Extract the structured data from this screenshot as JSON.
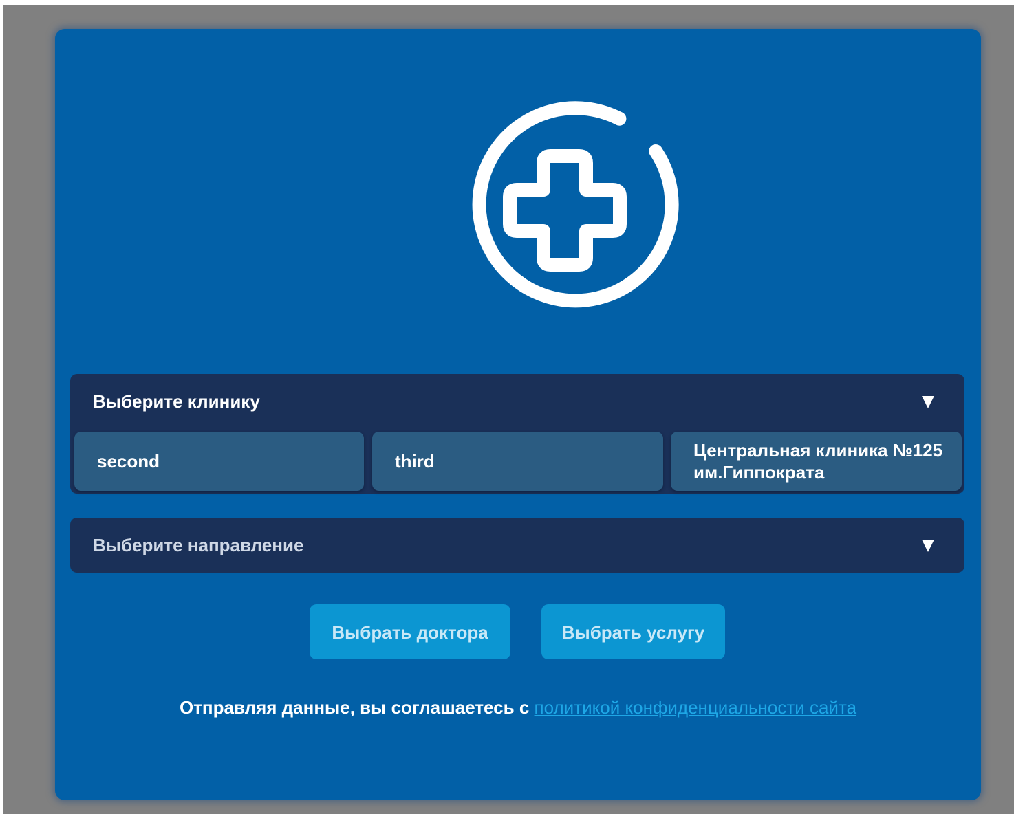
{
  "form": {
    "logo_icon": "medical-cross-icon",
    "clinic_select": {
      "label": "Выберите клинику",
      "options": [
        {
          "label": "second"
        },
        {
          "label": "third"
        },
        {
          "label": "Центральная клиника №125 им.Гиппократа"
        }
      ]
    },
    "direction_select": {
      "label": "Выберите направление"
    },
    "buttons": {
      "doctor": "Выбрать доктора",
      "service": "Выбрать услугу"
    },
    "consent": {
      "text": "Отправляя данные, вы соглашаетесь с",
      "link": "политикой конфиденциальности сайта"
    }
  },
  "colors": {
    "page_backdrop": "#808080",
    "card_background": "#0260a7",
    "select_background": "#1a3058",
    "option_background": "#2b5c82",
    "button_background": "#0c96d2",
    "link": "#1ea7e6"
  }
}
